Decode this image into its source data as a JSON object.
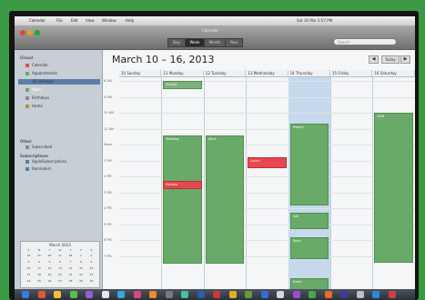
{
  "app": {
    "menu": [
      "Calendar",
      "File",
      "Edit",
      "View",
      "Window",
      "Help"
    ],
    "clock": "Sat 16 Mar 2:57 PM",
    "window_title": "Calendar"
  },
  "toolbar": {
    "segments": [
      "Day",
      "Week",
      "Month",
      "Year"
    ],
    "active_segment": "Week",
    "search_placeholder": "Search"
  },
  "sidebar": {
    "section_on_my_mac": "iCloud",
    "calendars": [
      {
        "label": "Calendar",
        "color": "#e8474f"
      },
      {
        "label": "Appointments",
        "color": "#6aaa68"
      },
      {
        "label": "US Holidays",
        "color": "#5b7ea8"
      },
      {
        "label": "Work",
        "color": "#6aaa68",
        "selected": true
      },
      {
        "label": "Birthdays",
        "color": "#8a8a8a"
      },
      {
        "label": "Home",
        "color": "#c58a3a"
      }
    ],
    "section_other": "Other",
    "other_items": [
      {
        "label": "Subscribed"
      }
    ],
    "section_subscriptions": "Subscriptions",
    "sub_items": [
      {
        "label": "AppleSubscriptions"
      },
      {
        "label": "Reminders"
      }
    ],
    "minical": {
      "title": "March 2013",
      "weekdays": [
        "S",
        "M",
        "T",
        "W",
        "T",
        "F",
        "S"
      ],
      "days": [
        "24",
        "25",
        "26",
        "27",
        "28",
        "1",
        "2",
        "3",
        "4",
        "5",
        "6",
        "7",
        "8",
        "9",
        "10",
        "11",
        "12",
        "13",
        "14",
        "15",
        "16",
        "17",
        "18",
        "19",
        "20",
        "21",
        "22",
        "23",
        "24",
        "25",
        "26",
        "27",
        "28",
        "29",
        "30"
      ]
    }
  },
  "main": {
    "title": "March 10 – 16, 2013",
    "prev": "◀",
    "next": "▶",
    "today": "Today",
    "days": [
      "10 Sunday",
      "11 Monday",
      "12 Tuesday",
      "13 Wednesday",
      "14 Thursday",
      "15 Friday",
      "16 Saturday"
    ],
    "times": [
      "8 AM",
      "9 AM",
      "10 AM",
      "11 AM",
      "Noon",
      "1 PM",
      "2 PM",
      "3 PM",
      "4 PM",
      "5 PM",
      "6 PM",
      "7 PM"
    ],
    "events": [
      {
        "label": "All-day",
        "day": 1,
        "start": 0.0,
        "end": 0.5,
        "type": "allday"
      },
      {
        "label": "Meeting",
        "day": 1,
        "start": 3.4,
        "end": 11.5,
        "type": "green"
      },
      {
        "label": "Review",
        "day": 1,
        "start": 6.3,
        "end": 6.8,
        "type": "red"
      },
      {
        "label": "Work",
        "day": 2,
        "start": 3.4,
        "end": 11.5,
        "type": "green"
      },
      {
        "label": "Lunch",
        "day": 3,
        "start": 4.8,
        "end": 5.5,
        "type": "red"
      },
      {
        "label": "Project",
        "day": 4,
        "start": 2.7,
        "end": 7.8,
        "type": "green"
      },
      {
        "label": "Call",
        "day": 4,
        "start": 8.3,
        "end": 9.3,
        "type": "green"
      },
      {
        "label": "Team",
        "day": 4,
        "start": 9.8,
        "end": 11.2,
        "type": "green"
      },
      {
        "label": "Event",
        "day": 4,
        "start": 12.4,
        "end": 13.8,
        "type": "green"
      },
      {
        "label": "Shift",
        "day": 6,
        "start": 2.0,
        "end": 11.4,
        "type": "green"
      }
    ]
  }
}
